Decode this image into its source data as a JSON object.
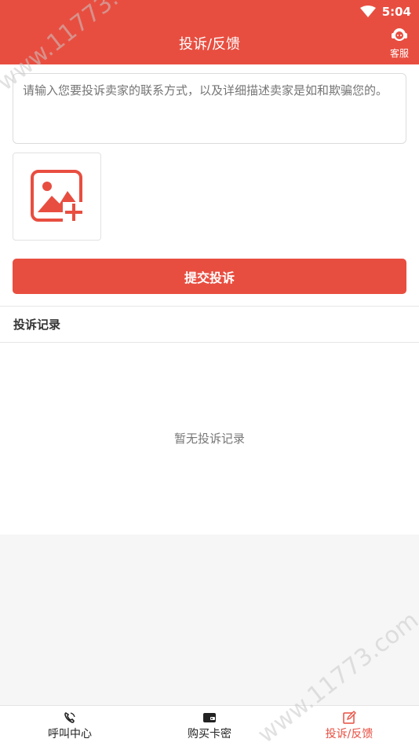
{
  "status": {
    "time": "5:04"
  },
  "header": {
    "title": "投诉/反馈",
    "service_label": "客服"
  },
  "form": {
    "placeholder": "请输入您要投诉卖家的联系方式，以及详细描述卖家是如和欺骗您的。",
    "submit_label": "提交投诉"
  },
  "records": {
    "title": "投诉记录",
    "empty_text": "暂无投诉记录"
  },
  "tabs": [
    {
      "label": "呼叫中心",
      "icon": "phone-icon"
    },
    {
      "label": "购买卡密",
      "icon": "wallet-icon"
    },
    {
      "label": "投诉/反馈",
      "icon": "edit-icon",
      "active": true
    }
  ],
  "watermark": "www.11773.com",
  "colors": {
    "accent": "#e84e40"
  }
}
